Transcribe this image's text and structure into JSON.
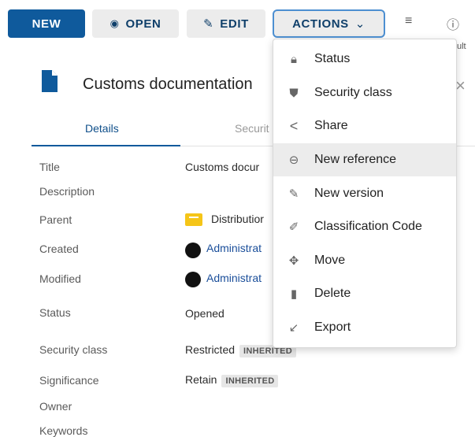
{
  "toolbar": {
    "new_label": "NEW",
    "open_label": "OPEN",
    "edit_label": "EDIT",
    "actions_label": "ACTIONS",
    "clipped_text": "ult"
  },
  "document": {
    "title": "Customs documentation"
  },
  "tabs": [
    {
      "label": "Details",
      "active": true
    },
    {
      "label": "Securit",
      "active": false
    }
  ],
  "properties": {
    "title": {
      "label": "Title",
      "value": "Customs docur"
    },
    "description": {
      "label": "Description",
      "value": ""
    },
    "parent": {
      "label": "Parent",
      "value": "Distributior"
    },
    "created": {
      "label": "Created",
      "value": "Administrat"
    },
    "modified": {
      "label": "Modified",
      "value": "Administrat"
    },
    "status": {
      "label": "Status",
      "value": "Opened"
    },
    "security_class": {
      "label": "Security class",
      "value": "Restricted",
      "badge": "INHERITED"
    },
    "significance": {
      "label": "Significance",
      "value": "Retain",
      "badge": "INHERITED"
    },
    "owner": {
      "label": "Owner",
      "value": ""
    },
    "keywords": {
      "label": "Keywords",
      "value": ""
    }
  },
  "actions_menu": {
    "items": [
      {
        "label": "Status",
        "icon": "lock-icon"
      },
      {
        "label": "Security class",
        "icon": "shield-icon"
      },
      {
        "label": "Share",
        "icon": "share-icon"
      },
      {
        "label": "New reference",
        "icon": "link-icon",
        "highlighted": true
      },
      {
        "label": "New version",
        "icon": "pencil-icon"
      },
      {
        "label": "Classification Code",
        "icon": "edit-square-icon"
      },
      {
        "label": "Move",
        "icon": "move-icon"
      },
      {
        "label": "Delete",
        "icon": "trash-icon"
      },
      {
        "label": "Export",
        "icon": "export-arrow-icon"
      }
    ]
  },
  "colors": {
    "primary": "#0f5a9c",
    "accent_border": "#4d8fd1",
    "link": "#1a4e9a",
    "folder": "#f5c518"
  }
}
